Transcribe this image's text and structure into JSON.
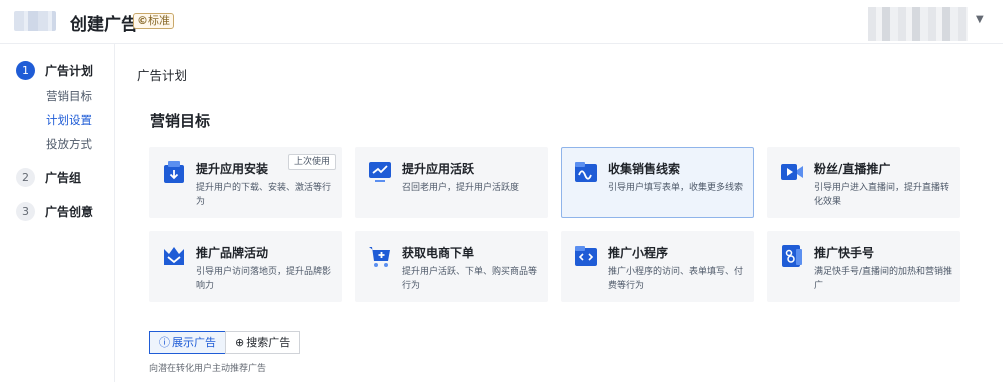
{
  "header": {
    "title": "创建广告",
    "badge_icon": "©",
    "badge_label": "标准"
  },
  "sidebar": {
    "steps": [
      {
        "num": "1",
        "label": "广告计划",
        "subs": [
          "营销目标",
          "计划设置",
          "投放方式"
        ]
      },
      {
        "num": "2",
        "label": "广告组"
      },
      {
        "num": "3",
        "label": "广告创意"
      }
    ]
  },
  "main": {
    "section_title": "广告计划",
    "goal_title": "营销目标",
    "cards": [
      {
        "title": "提升应用安装",
        "desc": "提升用户的下载、安装、激活等行为",
        "tag": "上次使用",
        "icon": "download-box-icon"
      },
      {
        "title": "提升应用活跃",
        "desc": "召回老用户，提升用户活跃度",
        "icon": "trend-screen-icon"
      },
      {
        "title": "收集销售线索",
        "desc": "引导用户填写表单，收集更多线索",
        "icon": "wave-folder-icon"
      },
      {
        "title": "粉丝/直播推广",
        "desc": "引导用户进入直播间，提升直播转化效果",
        "icon": "live-camera-icon"
      },
      {
        "title": "推广品牌活动",
        "desc": "引导用户访问落地页，提升品牌影响力",
        "icon": "crown-icon"
      },
      {
        "title": "获取电商下单",
        "desc": "提升用户活跃、下单、购买商品等行为",
        "icon": "cart-icon"
      },
      {
        "title": "推广小程序",
        "desc": "推广小程序的访问、表单填写、付费等行为",
        "icon": "mini-program-icon"
      },
      {
        "title": "推广快手号",
        "desc": "满足快手号/直播间的加热和营销推广",
        "icon": "account-icon"
      }
    ],
    "tabs": [
      {
        "icon": "ⓘ",
        "label": "展示广告"
      },
      {
        "icon": "⊕",
        "label": "搜索广告"
      }
    ],
    "hint": "向潜在转化用户主动推荐广告"
  },
  "colors": {
    "primary": "#1f5cd6",
    "card_bg": "#f5f6f8",
    "selected_border": "#8fb4ea"
  }
}
